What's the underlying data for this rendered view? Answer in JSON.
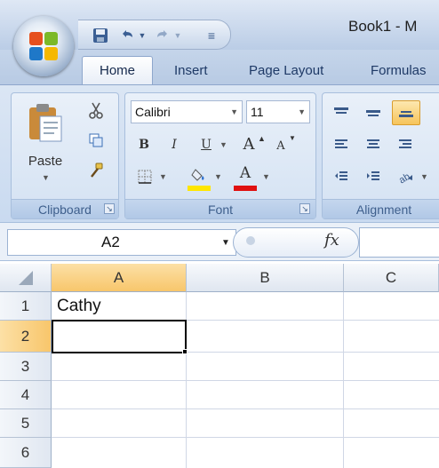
{
  "window": {
    "title": "Book1 - M"
  },
  "quick_access": {
    "save_icon": "save-icon",
    "undo_icon": "undo-icon",
    "redo_icon": "redo-icon",
    "customize_glyph": "≡"
  },
  "ribbon": {
    "tabs": [
      "Home",
      "Insert",
      "Page Layout",
      "Formulas"
    ],
    "active_tab": "Home",
    "clipboard": {
      "label": "Clipboard",
      "paste_label": "Paste"
    },
    "font": {
      "label": "Font",
      "font_name": "Calibri",
      "font_size": "11",
      "bold": "B",
      "italic": "I",
      "underline": "U",
      "grow": "A",
      "shrink": "A",
      "font_color_letter": "A",
      "highlight_color": "#ffe600",
      "font_color": "#e01010"
    },
    "alignment": {
      "label": "Alignment"
    }
  },
  "formula_bar": {
    "name_box": "A2",
    "fx_label": "fx",
    "formula": ""
  },
  "sheet": {
    "columns": [
      "A",
      "B",
      "C"
    ],
    "rows": [
      "1",
      "2",
      "3",
      "4",
      "5",
      "6"
    ],
    "cells": {
      "A1": "Cathy"
    },
    "active_cell": "A2",
    "accent_header": "#f8c66b"
  }
}
